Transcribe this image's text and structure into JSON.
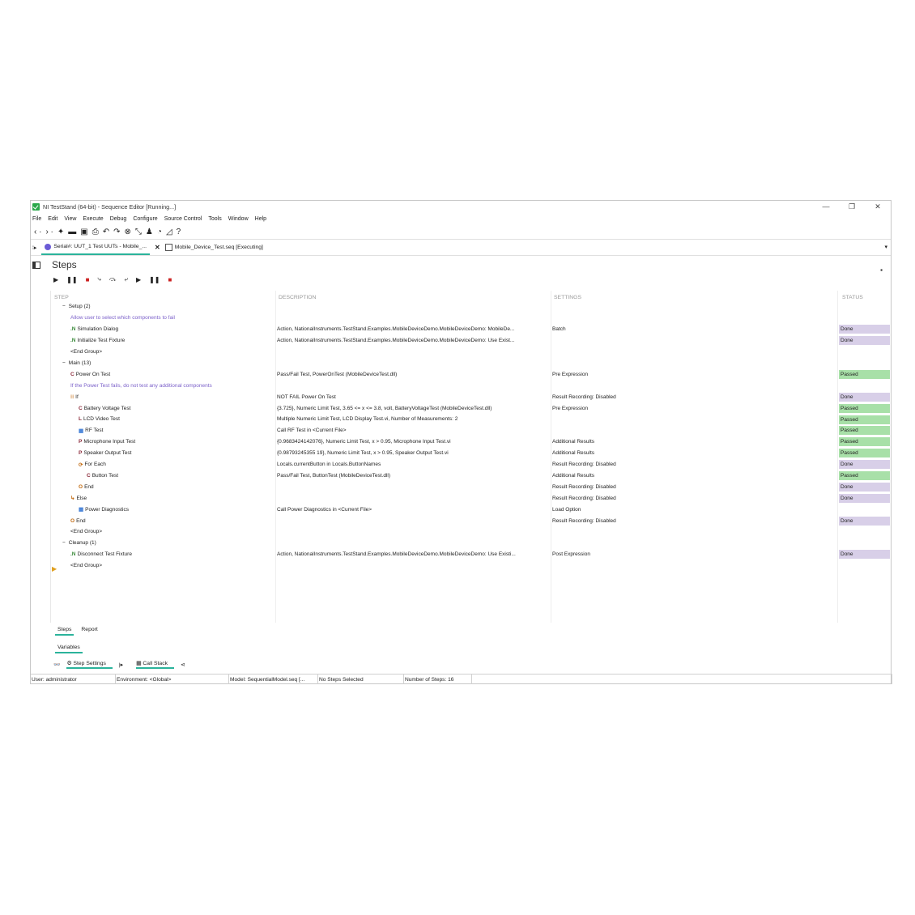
{
  "window": {
    "title": "NI TestStand (64-bit) - Sequence Editor [Running...]",
    "minimize": "—",
    "restore": "❐",
    "close": "✕"
  },
  "menu": [
    "File",
    "Edit",
    "View",
    "Execute",
    "Debug",
    "Configure",
    "Source Control",
    "Tools",
    "Window",
    "Help"
  ],
  "toolbar_icons": [
    "back-arrow-icon",
    "forward-arrow-icon",
    "new-icon",
    "open-folder-icon",
    "save-icon",
    "print-icon",
    "undo-icon",
    "redo-icon",
    "globe-icon",
    "step-icon",
    "user-icon",
    "gauge-icon",
    "chart-icon",
    "help-icon"
  ],
  "tabs": [
    {
      "label": "Serial#: UUT_1  Test UUTs - Mobile_...",
      "active": true
    },
    {
      "label": "Mobile_Device_Test.seq [Executing]",
      "active": false
    }
  ],
  "steps_title": "Steps",
  "columns": [
    "STEP",
    "DESCRIPTION",
    "SETTINGS",
    "STATUS"
  ],
  "rows": [
    {
      "step": "Setup (2)",
      "indent": 1,
      "expander": "−",
      "description": "",
      "settings": "",
      "status": ""
    },
    {
      "step": "Allow user to select which components to fail",
      "indent": 2,
      "comment": true,
      "description": "",
      "settings": "",
      "status": ""
    },
    {
      "step": "Simulation Dialog",
      "indent": 2,
      "type": ".N",
      "tclass": "t-n",
      "description": "Action,  NationalInstruments.TestStand.Examples.MobileDeviceDemo.MobileDeviceDemo: MobileDe...",
      "settings": "Batch",
      "status": "Done"
    },
    {
      "step": "Initialize Test Fixture",
      "indent": 2,
      "type": ".N",
      "tclass": "t-n",
      "description": "Action,  NationalInstruments.TestStand.Examples.MobileDeviceDemo.MobileDeviceDemo: Use Exist...",
      "settings": "",
      "status": "Done"
    },
    {
      "step": "<End Group>",
      "indent": 2,
      "description": "",
      "settings": "",
      "status": ""
    },
    {
      "step": "Main (13)",
      "indent": 1,
      "expander": "−",
      "description": "",
      "settings": "",
      "status": ""
    },
    {
      "step": "Power On Test",
      "indent": 2,
      "type": "C",
      "tclass": "t-c",
      "description": "Pass/Fail Test,  PowerOnTest (MobileDeviceTest.dll)",
      "settings": "Pre Expression",
      "status": "Passed"
    },
    {
      "step": "If the Power Test fails, do not test any additional components",
      "indent": 2,
      "comment": true,
      "description": "",
      "settings": "",
      "status": ""
    },
    {
      "step": "If",
      "indent": 2,
      "type": "⁝⁝",
      "tclass": "t-o",
      "description": "NOT FAIL Power On Test",
      "settings": "Result Recording: Disabled",
      "status": "Done"
    },
    {
      "step": "Battery Voltage Test",
      "indent": 3,
      "type": "C",
      "tclass": "t-c",
      "description": "{3.725},  Numeric Limit Test,  3.65 <= x <= 3.8, volt, BatteryVoltageTest (MobileDeviceTest.dll)",
      "settings": "Pre Expression",
      "status": "Passed"
    },
    {
      "step": "LCD Video Test",
      "indent": 3,
      "type": "L",
      "tclass": "t-l",
      "description": "Multiple Numeric Limit Test,  LCD Display Test.vi, Number of Measurements: 2",
      "settings": "",
      "status": "Passed"
    },
    {
      "step": "RF Test",
      "indent": 3,
      "type": "▦",
      "tclass": "t-blue",
      "description": "Call RF Test in <Current File>",
      "settings": "",
      "status": "Passed"
    },
    {
      "step": "Microphone Input Test",
      "indent": 3,
      "type": "P",
      "tclass": "t-p",
      "description": "{0.9683424142076},  Numeric Limit Test,  x > 0.95, Microphone Input Test.vi",
      "settings": "Additional Results",
      "status": "Passed"
    },
    {
      "step": "Speaker Output Test",
      "indent": 3,
      "type": "P",
      "tclass": "t-p",
      "description": "{0.98793245355 19},  Numeric Limit Test,  x > 0.95, Speaker Output Test.vi",
      "settings": "Additional Results",
      "status": "Passed"
    },
    {
      "step": "For Each",
      "indent": 3,
      "type": "⟳",
      "tclass": "t-o",
      "description": "Locals.currentButton in Locals.ButtonNames",
      "settings": "Result Recording: Disabled",
      "status": "Done"
    },
    {
      "step": "Button Test",
      "indent": 4,
      "type": "C",
      "tclass": "t-c",
      "description": "Pass/Fail Test,  ButtonTest (MobileDeviceTest.dll)",
      "settings": "Additional Results",
      "status": "Passed"
    },
    {
      "step": "End",
      "indent": 3,
      "type": "O",
      "tclass": "t-o",
      "description": "",
      "settings": "Result Recording: Disabled",
      "status": "Done"
    },
    {
      "step": "Else",
      "indent": 2,
      "type": "↳",
      "tclass": "t-o",
      "description": "",
      "settings": "Result Recording: Disabled",
      "status": "Done"
    },
    {
      "step": "Power Diagnostics",
      "indent": 3,
      "type": "▦",
      "tclass": "t-blue",
      "description": "Call Power Diagnostics in <Current File>",
      "settings": "Load Option",
      "status": ""
    },
    {
      "step": "End",
      "indent": 2,
      "type": "O",
      "tclass": "t-o",
      "description": "",
      "settings": "Result Recording: Disabled",
      "status": "Done"
    },
    {
      "step": "<End Group>",
      "indent": 2,
      "description": "",
      "settings": "",
      "status": ""
    },
    {
      "step": "Cleanup (1)",
      "indent": 1,
      "expander": "−",
      "description": "",
      "settings": "",
      "status": ""
    },
    {
      "step": "Disconnect Test Fixture",
      "indent": 2,
      "type": ".N",
      "tclass": "t-n",
      "description": "Action,  NationalInstruments.TestStand.Examples.MobileDeviceDemo.MobileDeviceDemo: Use Existi...",
      "settings": "Post Expression",
      "status": "Done"
    },
    {
      "step": "<End Group>",
      "indent": 2,
      "description": "",
      "settings": "",
      "status": ""
    }
  ],
  "bottom_tabs": [
    "Steps",
    "Report"
  ],
  "variables_label": "Variables",
  "dock": {
    "step_settings": "Step Settings",
    "call_stack": "Call Stack"
  },
  "statusbar": {
    "user": "User: administrator",
    "environment": "Environment: <Global>",
    "model": "Model: SequentialModel.seq [...",
    "selection": "No Steps Selected",
    "count": "Number of Steps: 16"
  },
  "colors": {
    "accent": "#2bb39b",
    "passed": "#a8e0a8",
    "done": "#d8cfe8",
    "comment": "#7a5fc9"
  }
}
